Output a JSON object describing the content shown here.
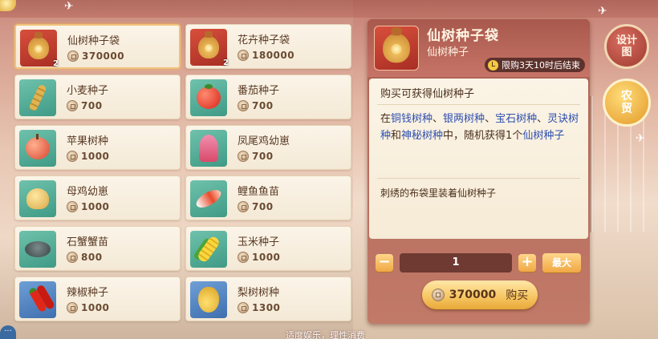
{
  "shop_items": [
    {
      "name": "仙树种子袋",
      "price": "370000",
      "count": "2",
      "icon": "seed-bag-icon",
      "bg": "red",
      "selected": true
    },
    {
      "name": "花卉种子袋",
      "price": "180000",
      "count": "2",
      "icon": "seed-bag-icon",
      "bg": "red",
      "selected": false
    },
    {
      "name": "小麦种子",
      "price": "700",
      "count": "",
      "icon": "wheat-icon",
      "bg": "teal",
      "selected": false
    },
    {
      "name": "番茄种子",
      "price": "700",
      "count": "",
      "icon": "tomato-icon",
      "bg": "teal",
      "selected": false
    },
    {
      "name": "苹果树种",
      "price": "1000",
      "count": "",
      "icon": "apple-icon",
      "bg": "teal",
      "selected": false
    },
    {
      "name": "凤尾鸡幼崽",
      "price": "700",
      "count": "",
      "icon": "phoenix-chick-icon",
      "bg": "teal",
      "selected": false
    },
    {
      "name": "母鸡幼崽",
      "price": "1000",
      "count": "",
      "icon": "chick-icon",
      "bg": "teal",
      "selected": false
    },
    {
      "name": "鲤鱼鱼苗",
      "price": "700",
      "count": "",
      "icon": "koi-icon",
      "bg": "teal",
      "selected": false
    },
    {
      "name": "石蟹蟹苗",
      "price": "800",
      "count": "",
      "icon": "crab-icon",
      "bg": "teal",
      "selected": false
    },
    {
      "name": "玉米种子",
      "price": "1000",
      "count": "",
      "icon": "corn-icon",
      "bg": "teal",
      "selected": false
    },
    {
      "name": "辣椒种子",
      "price": "1000",
      "count": "",
      "icon": "chili-icon",
      "bg": "blue",
      "selected": false
    },
    {
      "name": "梨树树种",
      "price": "1300",
      "count": "",
      "icon": "pear-icon",
      "bg": "blue",
      "selected": false
    }
  ],
  "detail": {
    "title": "仙树种子袋",
    "subtitle": "仙树种子",
    "limit": "限购3天10时后结束",
    "line1": "购买可获得仙树种子",
    "detail_parts": [
      "在",
      "铜钱树种",
      "、",
      "银两树种",
      "、",
      "宝石树种",
      "、",
      "灵诀树种",
      "和",
      "神秘树种",
      "中，随机获得1个",
      "仙树种子"
    ],
    "flavor": "刺绣的布袋里装着仙树种子"
  },
  "quantity": {
    "minus": "−",
    "value": "1",
    "plus": "+",
    "max": "最大"
  },
  "buy": {
    "amount": "370000",
    "label": "购买"
  },
  "side_buttons": {
    "design": "设计图",
    "trade": "农贸"
  },
  "footer": "适度娱乐，理性消费",
  "chat_label": "···"
}
